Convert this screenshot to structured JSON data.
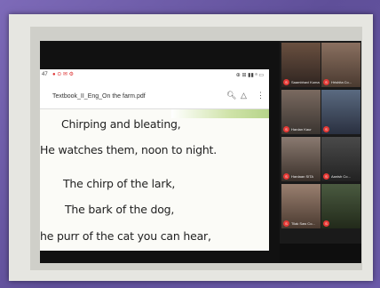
{
  "status_bar": {
    "time": "47",
    "icons_left": "● ⊙ ✉ ⚙",
    "icons_right": "⊕ ⊞ ▮▮ ᵃ ▭"
  },
  "pdf_header": {
    "title": "Textbook_II_Eng_On the farm.pdf",
    "icons": [
      "search-icon",
      "drive-icon",
      "more-icon"
    ]
  },
  "poem_lines": [
    "Chirping and bleating,",
    "He watches them, noon to night.",
    "The chirp of the lark,",
    "The bark of the dog,",
    "he purr of the cat you can hear,"
  ],
  "participants": [
    {
      "name": "Saambhavi Kumar",
      "initial": "S"
    },
    {
      "name": "Hrishita Co...",
      "initial": "S"
    },
    {
      "name": "Hardan Kaur",
      "initial": "S"
    },
    {
      "name": "",
      "initial": "S"
    },
    {
      "name": "Hardaan SITA",
      "initial": "S"
    },
    {
      "name": "Aanish Co...",
      "initial": "S"
    },
    {
      "name": "Tilak Saw Co...",
      "initial": "S"
    },
    {
      "name": "",
      "initial": "S"
    }
  ]
}
